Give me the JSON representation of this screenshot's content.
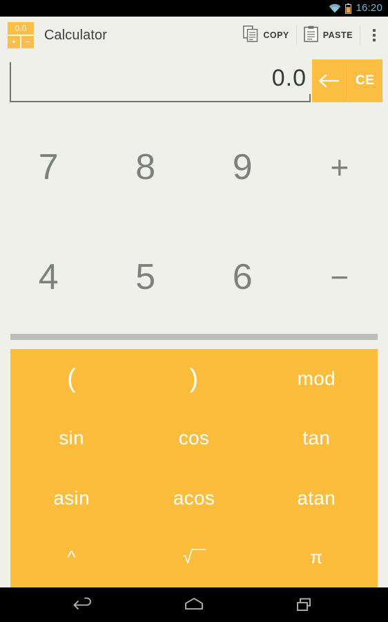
{
  "status_bar": {
    "wifi_icon": "wifi-icon",
    "battery_icon": "battery-icon",
    "clock": "16:20",
    "clock_color": "#70B8D8",
    "battery_color": "#F2A13A"
  },
  "action_bar": {
    "app_icon": {
      "name": "calculator-app-icon",
      "display_text": "0.0",
      "plus_label": "+",
      "minus_label": "−",
      "color": "#FBBF45"
    },
    "title": "Calculator",
    "copy_button": {
      "label": "COPY",
      "icon": "copy-icon"
    },
    "paste_button": {
      "label": "PASTE",
      "icon": "clipboard-paste-icon"
    },
    "overflow_button": {
      "icon": "overflow-menu-icon"
    }
  },
  "display": {
    "value": "0.0",
    "backspace_icon": "backspace-arrow-icon",
    "clear_entry_label": "CE",
    "accent_color": "#FBBE42",
    "text_color": "#333A37"
  },
  "keypad": {
    "keys": [
      {
        "label": "7",
        "type": "digit"
      },
      {
        "label": "8",
        "type": "digit"
      },
      {
        "label": "9",
        "type": "digit"
      },
      {
        "label": "+",
        "type": "operator"
      },
      {
        "label": "4",
        "type": "digit"
      },
      {
        "label": "5",
        "type": "digit"
      },
      {
        "label": "6",
        "type": "digit"
      },
      {
        "label": "−",
        "type": "operator"
      }
    ],
    "key_color": "#7D817C",
    "background": "#F0F0EA"
  },
  "divider": {
    "color": "#BDBDBD"
  },
  "function_panel": {
    "background": "#FDBD3C",
    "text_color": "#FFFFFF",
    "keys": [
      {
        "label": "(",
        "style": "paren"
      },
      {
        "label": ")",
        "style": "paren"
      },
      {
        "label": "mod",
        "style": "word"
      },
      {
        "label": "sin",
        "style": "word"
      },
      {
        "label": "cos",
        "style": "word"
      },
      {
        "label": "tan",
        "style": "word"
      },
      {
        "label": "asin",
        "style": "word"
      },
      {
        "label": "acos",
        "style": "word"
      },
      {
        "label": "atan",
        "style": "word"
      },
      {
        "label": "^",
        "style": "sym"
      },
      {
        "label": "√‾‾",
        "style": "sym"
      },
      {
        "label": "π",
        "style": "sym"
      }
    ]
  },
  "nav_bar": {
    "back_icon": "back-arrow-icon",
    "home_icon": "home-icon",
    "recents_icon": "recent-apps-icon",
    "background": "#000000"
  }
}
